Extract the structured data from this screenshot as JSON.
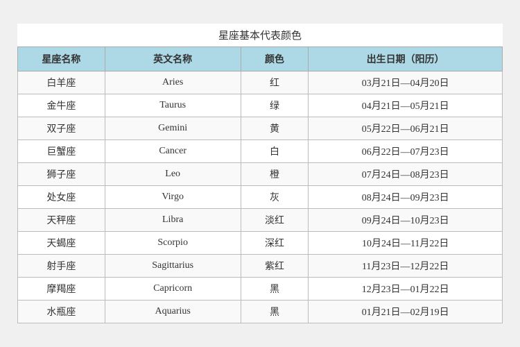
{
  "title": "星座基本代表颜色",
  "headers": [
    "星座名称",
    "英文名称",
    "颜色",
    "出生日期（阳历）"
  ],
  "rows": [
    {
      "chinese": "白羊座",
      "english": "Aries",
      "color": "红",
      "date": "03月21日—04月20日"
    },
    {
      "chinese": "金牛座",
      "english": "Taurus",
      "color": "绿",
      "date": "04月21日—05月21日"
    },
    {
      "chinese": "双子座",
      "english": "Gemini",
      "color": "黄",
      "date": "05月22日—06月21日"
    },
    {
      "chinese": "巨蟹座",
      "english": "Cancer",
      "color": "白",
      "date": "06月22日—07月23日"
    },
    {
      "chinese": "狮子座",
      "english": "Leo",
      "color": "橙",
      "date": "07月24日—08月23日"
    },
    {
      "chinese": "处女座",
      "english": "Virgo",
      "color": "灰",
      "date": "08月24日—09月23日"
    },
    {
      "chinese": "天秤座",
      "english": "Libra",
      "color": "淡红",
      "date": "09月24日—10月23日"
    },
    {
      "chinese": "天蝎座",
      "english": "Scorpio",
      "color": "深红",
      "date": "10月24日—11月22日"
    },
    {
      "chinese": "射手座",
      "english": "Sagittarius",
      "color": "紫红",
      "date": "11月23日—12月22日"
    },
    {
      "chinese": "摩羯座",
      "english": "Capricorn",
      "color": "黑",
      "date": "12月23日—01月22日"
    },
    {
      "chinese": "水瓶座",
      "english": "Aquarius",
      "color": "黑",
      "date": "01月21日—02月19日"
    }
  ]
}
